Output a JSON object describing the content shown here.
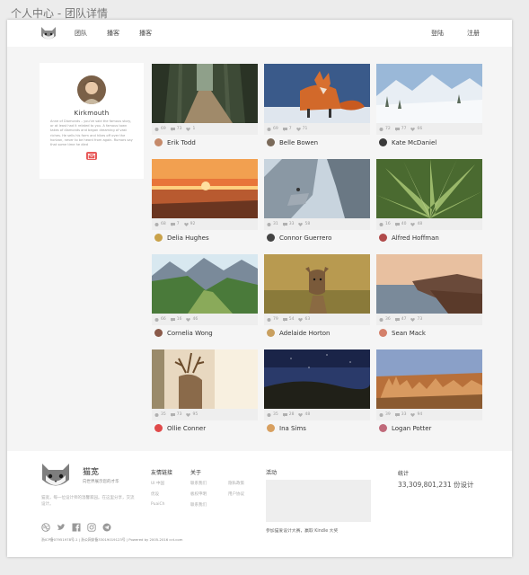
{
  "window": {
    "title": "个人中心 - 团队详情"
  },
  "nav": {
    "left": [
      "团队",
      "播客",
      "播客"
    ],
    "right": [
      "登陆",
      "注册"
    ]
  },
  "profile": {
    "name": "Kirkmouth",
    "bio": "Anne of Diamonds – you've said the famous story, or at least had it related to you. A famous town takes of diamonds and began dreaming of vast riches. He sells his farm and hikes off over the horizon, never to be heard from again. Rumors say that some time he died"
  },
  "cards": [
    {
      "author": "Erik Todd",
      "views": "69",
      "comments": "73",
      "likes": "1",
      "photo": "forest-path",
      "avatar_color": "#c58a6a"
    },
    {
      "author": "Belle Bowen",
      "views": "69",
      "comments": "7",
      "likes": "71",
      "photo": "fox",
      "avatar_color": "#7a6a5a"
    },
    {
      "author": "Kate McDaniel",
      "views": "72",
      "comments": "77",
      "likes": "66",
      "photo": "snowy-mountains",
      "avatar_color": "#3a3a3a"
    },
    {
      "author": "Delia Hughes",
      "views": "68",
      "comments": "7",
      "likes": "92",
      "photo": "sunset-sea",
      "avatar_color": "#c9a24a"
    },
    {
      "author": "Connor Guerrero",
      "views": "31",
      "comments": "33",
      "likes": "58",
      "photo": "cliffs",
      "avatar_color": "#444"
    },
    {
      "author": "Alfred Hoffman",
      "views": "16",
      "comments": "40",
      "likes": "48",
      "photo": "agave-plant",
      "avatar_color": "#b04a4a"
    },
    {
      "author": "Cornelia Wong",
      "views": "66",
      "comments": "16",
      "likes": "46",
      "photo": "green-valley",
      "avatar_color": "#8a5a4a"
    },
    {
      "author": "Adelaide Horton",
      "views": "79",
      "comments": "54",
      "likes": "63",
      "photo": "young-deer",
      "avatar_color": "#c9a060"
    },
    {
      "author": "Sean Mack",
      "views": "36",
      "comments": "47",
      "likes": "73",
      "photo": "coast-rocks",
      "avatar_color": "#d4806a"
    },
    {
      "author": "Ollie Conner",
      "views": "35",
      "comments": "73",
      "likes": "95",
      "photo": "stag",
      "avatar_color": "#e04a4a"
    },
    {
      "author": "Ina Sims",
      "views": "35",
      "comments": "28",
      "likes": "48",
      "photo": "night-sky",
      "avatar_color": "#d8a060"
    },
    {
      "author": "Logan Potter",
      "views": "39",
      "comments": "33",
      "likes": "94",
      "photo": "canyon",
      "avatar_color": "#c06a7a"
    }
  ],
  "footer": {
    "brand": "猫宽",
    "slogan": "向世界展示您的才华",
    "desc": "猫宽，每一位设计师的温馨家园。在这里分享，交流设计。",
    "col1_title": "友情链接",
    "col1_links": [
      "UI 中国",
      "优设",
      "PuaiCh"
    ],
    "col2_title": "关于",
    "col2_links_a": [
      "联系我们",
      "板权申明",
      "联系我们"
    ],
    "col2_links_b": [
      "隐私政策",
      "用户协议"
    ],
    "activity_title": "活动",
    "activity_text": "参加猫爱设计大赛，赢取 Kindle 大奖",
    "stats_title": "统计",
    "stats_value": "33,309,801,231 份设计",
    "copyright": "浙ICP备07951978号-1 | 浙公网安备33019019123号 | Powered by 2005-2016 cct.com"
  },
  "colors": {
    "accent": "#e85b5b",
    "main_bg": "#f5f5f5",
    "stats_bg": "#eeeeee"
  }
}
